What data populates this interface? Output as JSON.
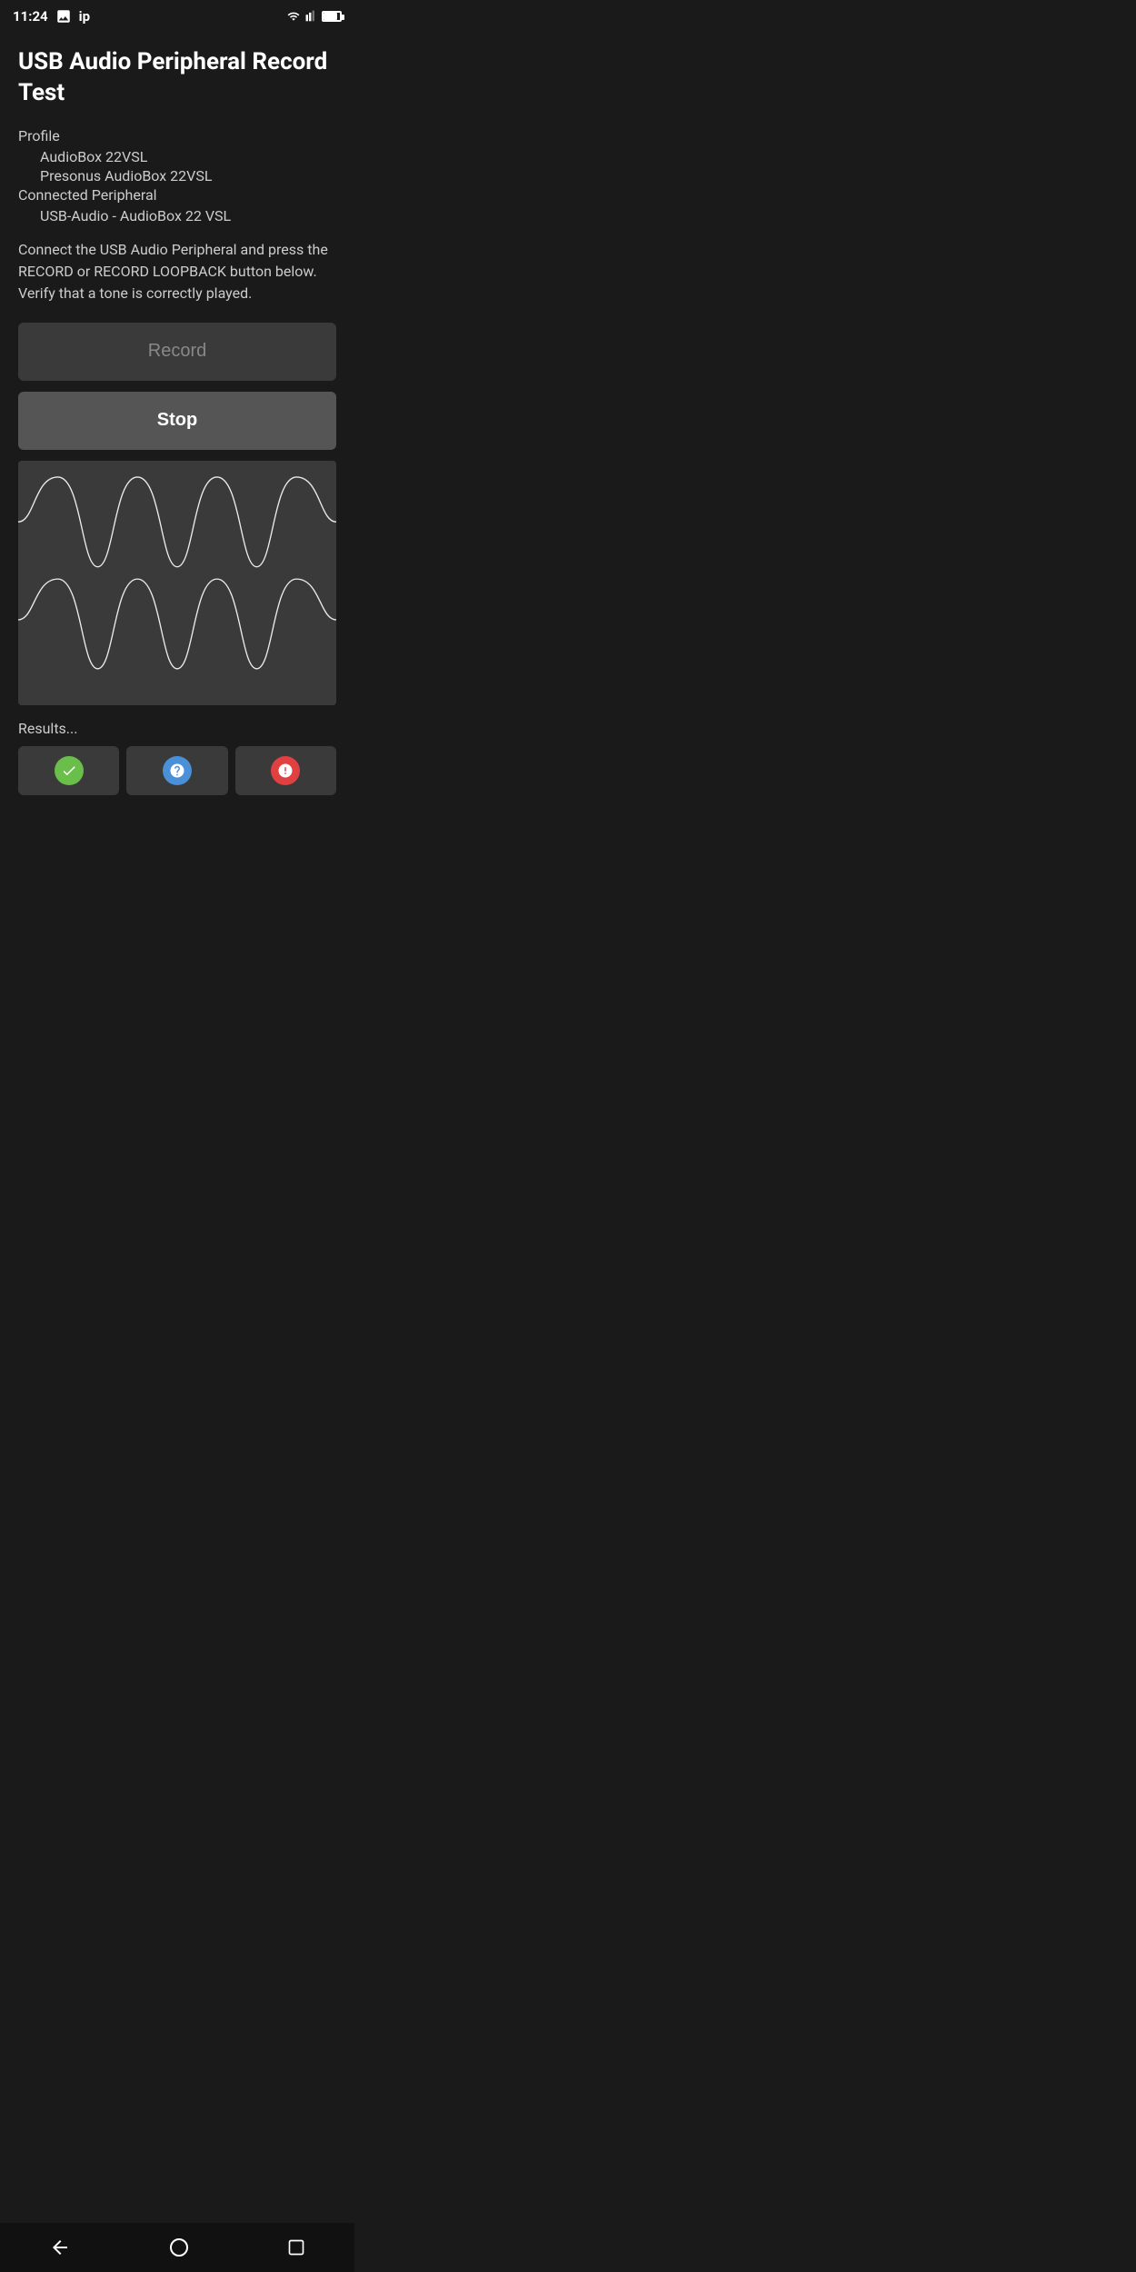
{
  "status_bar": {
    "time": "11:24",
    "photo_icon": "photo",
    "label": "ip"
  },
  "page": {
    "title": "USB Audio Peripheral Record Test",
    "profile_label": "Profile",
    "profile_name": "AudioBox 22VSL",
    "profile_full": "Presonus AudioBox 22VSL",
    "connected_label": "Connected Peripheral",
    "connected_value": "USB-Audio - AudioBox 22 VSL",
    "instruction": "Connect the USB Audio Peripheral and press the RECORD or RECORD LOOPBACK button below. Verify that a tone is correctly played.",
    "record_button": "Record",
    "stop_button": "Stop",
    "results_label": "Results..."
  }
}
